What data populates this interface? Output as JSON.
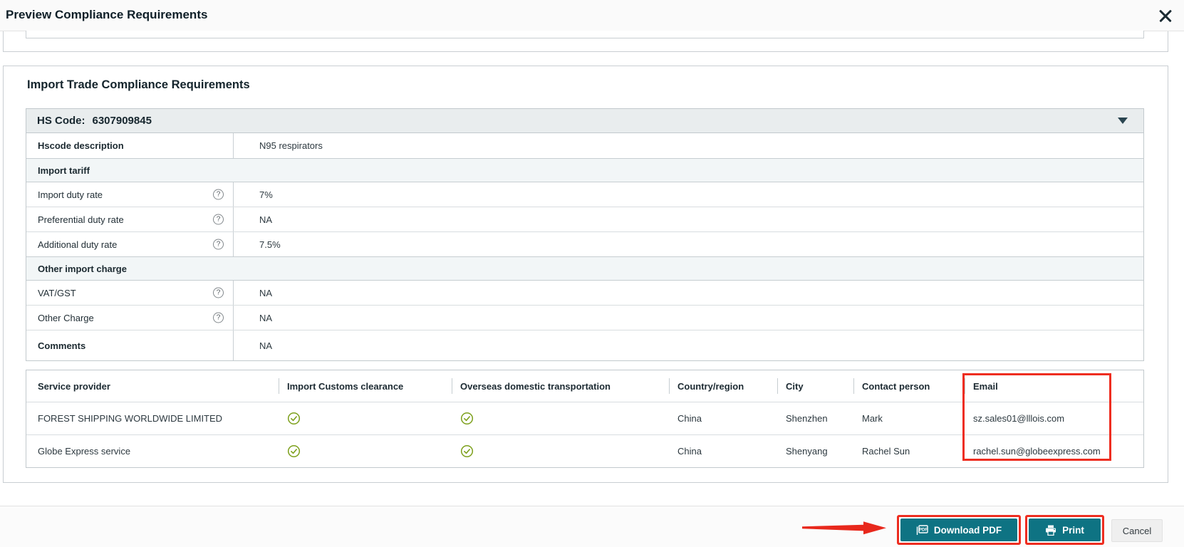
{
  "modal": {
    "title": "Preview Compliance Requirements"
  },
  "section": {
    "title": "Import Trade Compliance Requirements"
  },
  "hs_panel": {
    "header_label": "HS Code:",
    "header_value": "6307909845",
    "rows": [
      {
        "type": "data",
        "label": "Hscode description",
        "value": "N95 respirators"
      },
      {
        "type": "section",
        "label": "Import tariff"
      },
      {
        "type": "data",
        "label": "Import duty rate",
        "value": "7%"
      },
      {
        "type": "data",
        "label": "Preferential duty rate",
        "value": "NA"
      },
      {
        "type": "data",
        "label": "Additional duty rate",
        "value": "7.5%"
      },
      {
        "type": "section",
        "label": "Other import charge"
      },
      {
        "type": "data",
        "label": "VAT/GST",
        "value": "NA"
      },
      {
        "type": "data",
        "label": "Other Charge",
        "value": "NA"
      },
      {
        "type": "data",
        "label": "Comments",
        "value": "NA"
      }
    ]
  },
  "providers": {
    "columns": [
      "Service provider",
      "Import Customs clearance",
      "Overseas domestic transportation",
      "Country/region",
      "City",
      "Contact person",
      "Email"
    ],
    "rows": [
      {
        "name": "FOREST SHIPPING WORLDWIDE LIMITED",
        "import_customs_clearance": true,
        "overseas_domestic_transportation": true,
        "country": "China",
        "city": "Shenzhen",
        "contact": "Mark",
        "email": "sz.sales01@lllois.com"
      },
      {
        "name": "Globe Express service",
        "import_customs_clearance": true,
        "overseas_domestic_transportation": true,
        "country": "China",
        "city": "Shenyang",
        "contact": "Rachel Sun",
        "email": "rachel.sun@globeexpress.com"
      }
    ]
  },
  "footer": {
    "download_label": "Download PDF",
    "print_label": "Print",
    "cancel_label": "Cancel"
  },
  "icons": {
    "help": "?"
  },
  "colors": {
    "accent_teal": "#0e7383",
    "annotation_red": "#ee2d20",
    "check_green": "#7da01c"
  }
}
